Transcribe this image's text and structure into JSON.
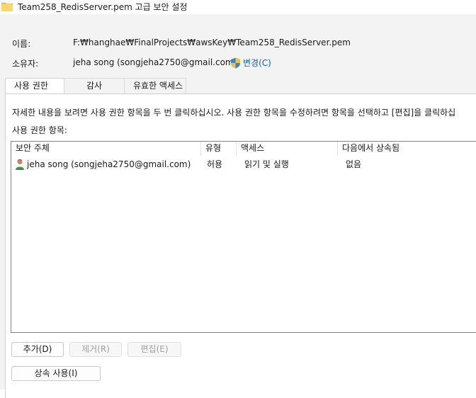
{
  "window": {
    "title": "Team258_RedisServer.pem 고급 보안 설정"
  },
  "fields": {
    "name_label": "이름:",
    "name_value": "F:₩hanghae₩FinalProjects₩awsKey₩Team258_RedisServer.pem",
    "owner_label": "소유자:",
    "owner_value": "jeha song (songjeha2750@gmail.com)",
    "change_label": "변경(C)"
  },
  "tabs": [
    {
      "label": "사용 권한"
    },
    {
      "label": "감사"
    },
    {
      "label": "유효한 액세스"
    }
  ],
  "panel": {
    "instructions": "자세한 내용을 보려면 사용 권한 항목을 두 번 클릭하십시오. 사용 권한 항목을 수정하려면 항목을 선택하고 [편집]을 클릭하십",
    "entries_label": "사용 권한 항목:"
  },
  "table": {
    "columns": [
      "보안 주체",
      "유형",
      "액세스",
      "다음에서 상속됨"
    ],
    "rows": [
      {
        "principal": "jeha song (songjeha2750@gmail.com)",
        "type": "허용",
        "access": "읽기 및 실행",
        "inherited": "없음"
      }
    ]
  },
  "buttons": {
    "add": "추가(D)",
    "remove": "제거(R)",
    "edit": "편집(E)",
    "inheritance": "상속 사용(I)"
  },
  "icons": {
    "title": "folder-icon",
    "change": "uac-shield-icon",
    "principal": "user-icon"
  }
}
